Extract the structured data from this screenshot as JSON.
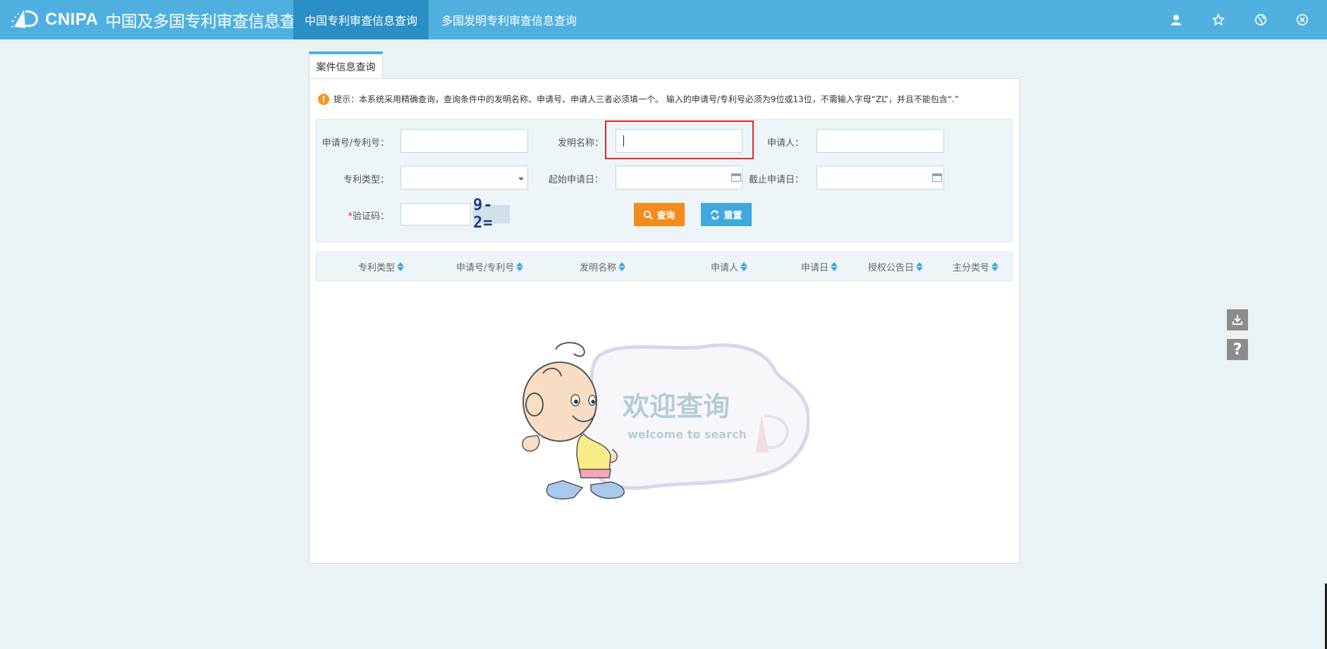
{
  "header": {
    "logo_text": "CNIPA",
    "site_title": "中国及多国专利审查信息查询",
    "tabs": [
      {
        "label": "中国专利审查信息查询",
        "active": true
      },
      {
        "label": "多国发明专利审查信息查询",
        "active": false
      }
    ],
    "icons": [
      "user-icon",
      "star-icon",
      "globe-icon",
      "close-icon"
    ],
    "bar_color": "#4fb0e0",
    "active_tab_color": "#2a8fc4"
  },
  "panel": {
    "tab_label": "案件信息查询",
    "hint": "提示：本系统采用精确查询，查询条件中的发明名称、申请号、申请人三者必须填一个。 输入的申请号/专利号必须为9位或13位，不需输入字母“ZL”，并且不能包含“.”"
  },
  "form": {
    "application_number": {
      "label": "申请号/专利号：",
      "value": ""
    },
    "invention_name": {
      "label": "发明名称：",
      "value": ""
    },
    "applicant": {
      "label": "申请人：",
      "value": ""
    },
    "patent_type": {
      "label": "专利类型：",
      "value": ""
    },
    "start_date": {
      "label": "起始申请日：",
      "value": ""
    },
    "end_date": {
      "label": "截止申请日：",
      "value": ""
    },
    "captcha": {
      "required_mark": "*",
      "label": "验证码：",
      "value": "",
      "image_text": "9-2="
    },
    "query_button": "查询",
    "reset_button": "重置",
    "query_color": "#f58b1b",
    "reset_color": "#3fa8dd"
  },
  "table": {
    "columns": [
      "专利类型",
      "申请号/专利号",
      "发明名称",
      "申请人",
      "申请日",
      "授权公告日",
      "主分类号"
    ]
  },
  "empty_state": {
    "title": "欢迎查询",
    "subtitle": "welcome to search"
  },
  "side_tools": [
    "download-icon",
    "help-icon"
  ]
}
